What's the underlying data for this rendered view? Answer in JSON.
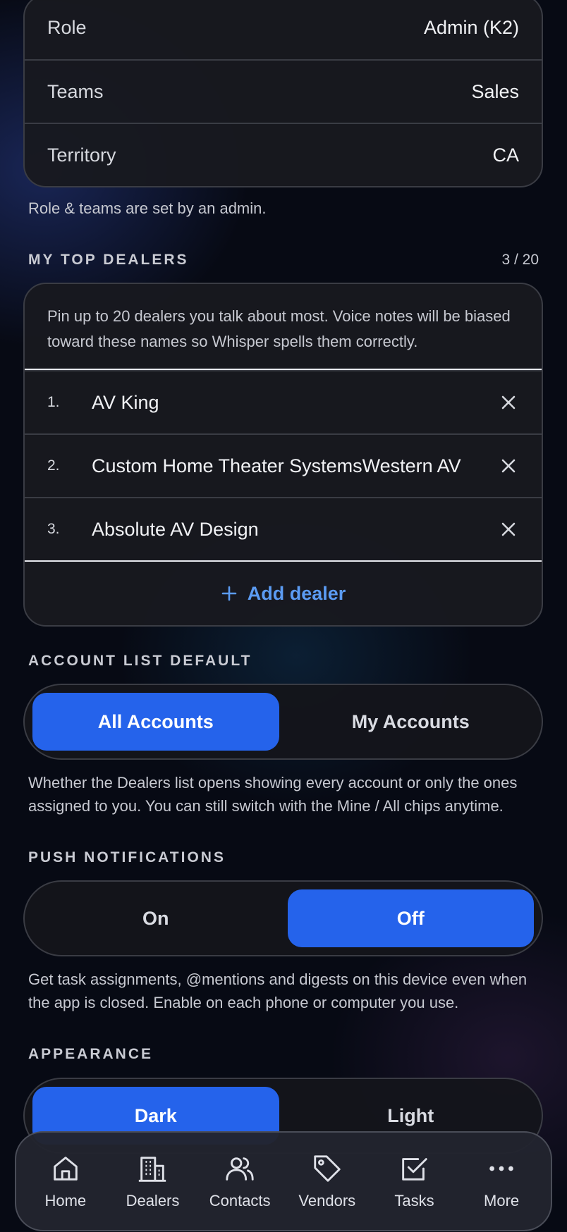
{
  "profile": {
    "rows": [
      {
        "label": "Role",
        "value": "Admin (K2)"
      },
      {
        "label": "Teams",
        "value": "Sales"
      },
      {
        "label": "Territory",
        "value": "CA"
      }
    ],
    "hint": "Role & teams are set by an admin."
  },
  "top_dealers": {
    "title": "MY TOP DEALERS",
    "count": "3 / 20",
    "intro": "Pin up to 20 dealers you talk about most. Voice notes will be biased toward these names so Whisper spells them correctly.",
    "items": [
      {
        "num": "1.",
        "name": "AV King"
      },
      {
        "num": "2.",
        "name": "Custom Home Theater SystemsWestern AV"
      },
      {
        "num": "3.",
        "name": "Absolute AV Design"
      }
    ],
    "add_label": "Add dealer"
  },
  "account_list": {
    "title": "ACCOUNT LIST DEFAULT",
    "options": [
      "All Accounts",
      "My Accounts"
    ],
    "selected": "All Accounts",
    "hint": "Whether the Dealers list opens showing every account or only the ones assigned to you. You can still switch with the Mine / All chips anytime."
  },
  "push": {
    "title": "PUSH NOTIFICATIONS",
    "options": [
      "On",
      "Off"
    ],
    "selected": "Off",
    "hint": "Get task assignments, @mentions and digests on this device even when the app is closed. Enable on each phone or computer you use."
  },
  "appearance": {
    "title": "APPEARANCE",
    "options": [
      "Dark",
      "Light"
    ],
    "selected": "Dark"
  },
  "tabbar": {
    "items": [
      {
        "label": "Home",
        "icon": "home-icon"
      },
      {
        "label": "Dealers",
        "icon": "building-icon"
      },
      {
        "label": "Contacts",
        "icon": "contacts-icon"
      },
      {
        "label": "Vendors",
        "icon": "tag-icon"
      },
      {
        "label": "Tasks",
        "icon": "checkbox-icon"
      },
      {
        "label": "More",
        "icon": "more-icon"
      }
    ]
  },
  "colors": {
    "accent": "#2563eb",
    "link": "#5b9bf2",
    "background": "#070a14"
  }
}
